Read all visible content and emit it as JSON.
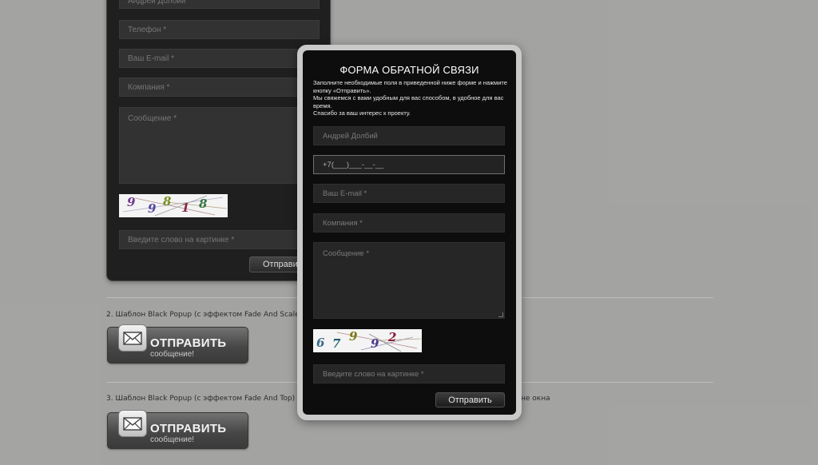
{
  "background_form": {
    "fields": [
      {
        "placeholder": "Андрей Долбий"
      },
      {
        "placeholder": "Телефон *"
      },
      {
        "placeholder": "Ваш E-mail *"
      },
      {
        "placeholder": "Компания *"
      },
      {
        "placeholder": "Сообщение *"
      }
    ],
    "captcha_digits": [
      "9",
      "9",
      "8",
      "1",
      "8"
    ],
    "captcha_input_placeholder": "Введите слово на картинке *",
    "submit_label": "Отправить"
  },
  "section2": {
    "caption": "2. Шаблон Black Popup (с эффектом Fade And Scale)",
    "button_title": "ОТПРАВИТЬ",
    "button_subtitle": "сообщение!"
  },
  "section3": {
    "caption_start": "3. Шаблон Black Popup (с эффектом Fade And Top) с к",
    "caption_end": "не окна",
    "button_title": "ОТПРАВИТЬ",
    "button_subtitle": "сообщение!"
  },
  "popup": {
    "title": "ФОРМА ОБРАТНОЙ СВЯЗИ",
    "intro": [
      "Заполните необходимые поля в приведенной ниже форме и нажмите кнопку «Отправить».",
      "Мы свяжемся с вами удобным для вас способом, в удобное для вас время.",
      "Спасибо за ваш интерес к проекту."
    ],
    "name_value": "Андрей Долбий",
    "phone_value": "+7(___)___-__-__",
    "email_placeholder": "Ваш E-mail *",
    "company_placeholder": "Компания *",
    "message_placeholder": "Сообщение *",
    "captcha_digits": [
      "6",
      "7",
      "9",
      "9",
      "2"
    ],
    "captcha_input_placeholder": "Введите слово на картинке *",
    "submit_label": "Отправить"
  },
  "colors": {
    "page_bg": "#9e9e9c",
    "form_bg": "#121212",
    "field_bg": "#262626",
    "popup_frame": "#c9c9c9"
  },
  "icons": [
    "envelope-icon",
    "resize-grip-icon"
  ]
}
